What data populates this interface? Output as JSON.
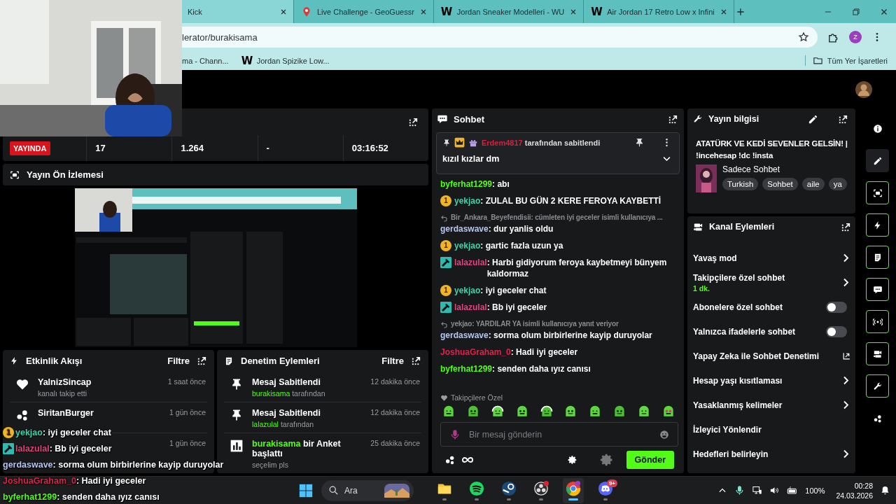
{
  "browser": {
    "tabs": [
      {
        "title": "Kick",
        "kind": "blank",
        "selected": true
      },
      {
        "title": "Live Challenge - GeoGuessr",
        "kind": "map",
        "selected": false
      },
      {
        "title": "Jordan Sneaker Modelleri - WU",
        "kind": "letter",
        "icon_text": "W",
        "selected": false
      },
      {
        "title": "Air Jordan 17 Retro Low x Infini",
        "kind": "letter",
        "icon_text": "W",
        "selected": false
      }
    ],
    "address": "lerator/burakisama",
    "profile_initial": "Z",
    "bookmarks": [
      {
        "title": "ma - Chann...",
        "kind": "blank"
      },
      {
        "title": "Jordan Spizike Low...",
        "kind": "letter",
        "icon_text": "W"
      }
    ],
    "all_bookmarks": "Tüm Yer İşaretleri"
  },
  "stats": {
    "live_badge": "YAYINDA",
    "values": [
      "17",
      "1.264",
      "-",
      "03:16:52"
    ]
  },
  "preview": {
    "title": "Yayın Ön İzlemesi",
    "kind": "picture"
  },
  "activity": {
    "title": "Etkinlik Akışı",
    "filter": "Filtre",
    "items": [
      {
        "kind": "follow",
        "name": "YalnizSincap",
        "detail": "kanalı takip etti",
        "time": "1 saat önce"
      },
      {
        "kind": "reward",
        "name": "SiritanBurger",
        "time": "1 gün önce"
      },
      {
        "time": "1 gün önce"
      }
    ]
  },
  "moderation": {
    "title": "Denetim Eylemleri",
    "filter": "Filtre",
    "items": [
      {
        "kind": "pin",
        "title": "Mesaj Sabitlendi",
        "user": "burakisama",
        "detail": "tarafından",
        "time": "12 dakika önce"
      },
      {
        "kind": "pin",
        "title": "Mesaj Sabitlendi",
        "user": "lalazulal",
        "detail": "tarafından",
        "time": "12 dakika önce"
      },
      {
        "kind": "poll",
        "user": "burakisama",
        "title": "bir Anket başlattı",
        "detail": "seçelim pls",
        "time": "25 dakika önce"
      }
    ]
  },
  "chat": {
    "title": "Sohbet",
    "pinned": {
      "by": "Erdem4817",
      "by_suffix": "tarafından sabitlendi",
      "message": "kızıl kızlar dm"
    },
    "messages": [
      {
        "kind": "plain",
        "user": "byferhat1299",
        "color": "#53fc18",
        "text": ": abı"
      },
      {
        "kind": "subscriber",
        "user": "yekjao",
        "color": "#3fd4a8",
        "badge_text": "1",
        "text": ": ZULAL BU GÜN 2 KERE FEROYA KAYBETTİ"
      },
      {
        "kind": "plain",
        "reply_to": "Bir_Ankara_Beyefendisii: cümleten iyi geceler isimli kullanıcıya ...",
        "user": "gerdaswave",
        "color": "#b4c6f0",
        "text": ": dur yanlis oldu"
      },
      {
        "kind": "subscriber",
        "user": "yekjao",
        "color": "#3fd4a8",
        "badge_text": "1",
        "text": ": gartic fazla uzun ya"
      },
      {
        "kind": "moderator",
        "user": "lalazulal",
        "color": "#e0437e",
        "text": ": Harbi gidiyorum feroya kaybetmeyi bünyem kaldormaz"
      },
      {
        "kind": "subscriber",
        "user": "yekjao",
        "color": "#3fd4a8",
        "badge_text": "1",
        "text": ": iyi geceler chat"
      },
      {
        "kind": "moderator",
        "user": "lalazulal",
        "color": "#e0437e",
        "text": ": Bb iyi geceler"
      },
      {
        "kind": "plain",
        "reply_to": "yekjao: YARDILAR YA isimli kullanıcıya yanıt veriyor",
        "user": "gerdaswave",
        "color": "#b4c6f0",
        "text": ": sorma olum birbirlerine kayip duruyolar"
      },
      {
        "kind": "plain",
        "user": "JoshuaGraham_0",
        "color": "#e0224a",
        "text": ": Hadi iyi geceler"
      },
      {
        "kind": "plain",
        "user": "byferhat1299",
        "color": "#53fc18",
        "text": ": senden daha ıyız canısı"
      }
    ],
    "emotes_label": "Takipçilere Özel",
    "placeholder": "Bir mesaj gönderin",
    "send": "Gönder"
  },
  "stream_info": {
    "title": "Yayın bilgisi",
    "stream_title": "ATATÜRK VE KEDİ SEVENLER GELSİN! | !incehesap !dc !insta",
    "category": "Sadece Sohbet",
    "tags": [
      "Turkish",
      "Sohbet",
      "aile",
      "ya"
    ]
  },
  "channel_actions": {
    "title": "Kanal Eylemleri",
    "items": [
      {
        "kind": "link",
        "label": "Yavaş mod"
      },
      {
        "kind": "link",
        "label": "Takipçilere özel sohbet",
        "detail": "1 dk."
      },
      {
        "kind": "toggle",
        "label": "Abonelere özel sohbet",
        "on": false
      },
      {
        "kind": "toggle",
        "label": "Yalnızca ifadelerle sohbet",
        "on": false
      },
      {
        "kind": "external",
        "label": "Yapay Zeka ile Sohbet Denetimi"
      },
      {
        "kind": "link",
        "label": "Hesap yaşı kısıtlaması"
      },
      {
        "kind": "link",
        "label": "Yasaklanmış kelimeler"
      },
      {
        "kind": "plain",
        "label": "İzleyici Yönlendir"
      },
      {
        "kind": "link",
        "label": "Hedefleri belirleyin"
      }
    ]
  },
  "overlay_chat": [
    {
      "kind": "subscriber",
      "user": "yekjao",
      "color": "#3fd4a8",
      "badge_text": "1",
      "text": " : iyi geceler chat"
    },
    {
      "kind": "moderator",
      "user": "lalazulal",
      "color": "#e0437e",
      "text": " : Bb iyi geceler"
    },
    {
      "kind": "plain",
      "user": "gerdaswave",
      "color": "#b4c6f0",
      "text": " : sorma olum birbirlerine kayip duruyolar"
    },
    {
      "kind": "plain",
      "user": "JoshuaGraham_0",
      "color": "#e0224a",
      "text": " : Hadi iyi geceler"
    },
    {
      "kind": "plain",
      "user": "byferhat1299",
      "color": "#53fc18",
      "text": " : senden daha ıyız canısı"
    }
  ],
  "taskbar": {
    "search_placeholder": "Ara",
    "apps": [
      {
        "kind": "folder",
        "active": false
      },
      {
        "kind": "spotify",
        "active": false
      },
      {
        "kind": "steam",
        "active": false
      },
      {
        "kind": "obs",
        "active": false
      },
      {
        "kind": "chrome",
        "active": true
      },
      {
        "kind": "discord",
        "active": false,
        "badge": "9+"
      }
    ],
    "battery": "100%",
    "time": "00:28",
    "date": "24.03.2026"
  }
}
